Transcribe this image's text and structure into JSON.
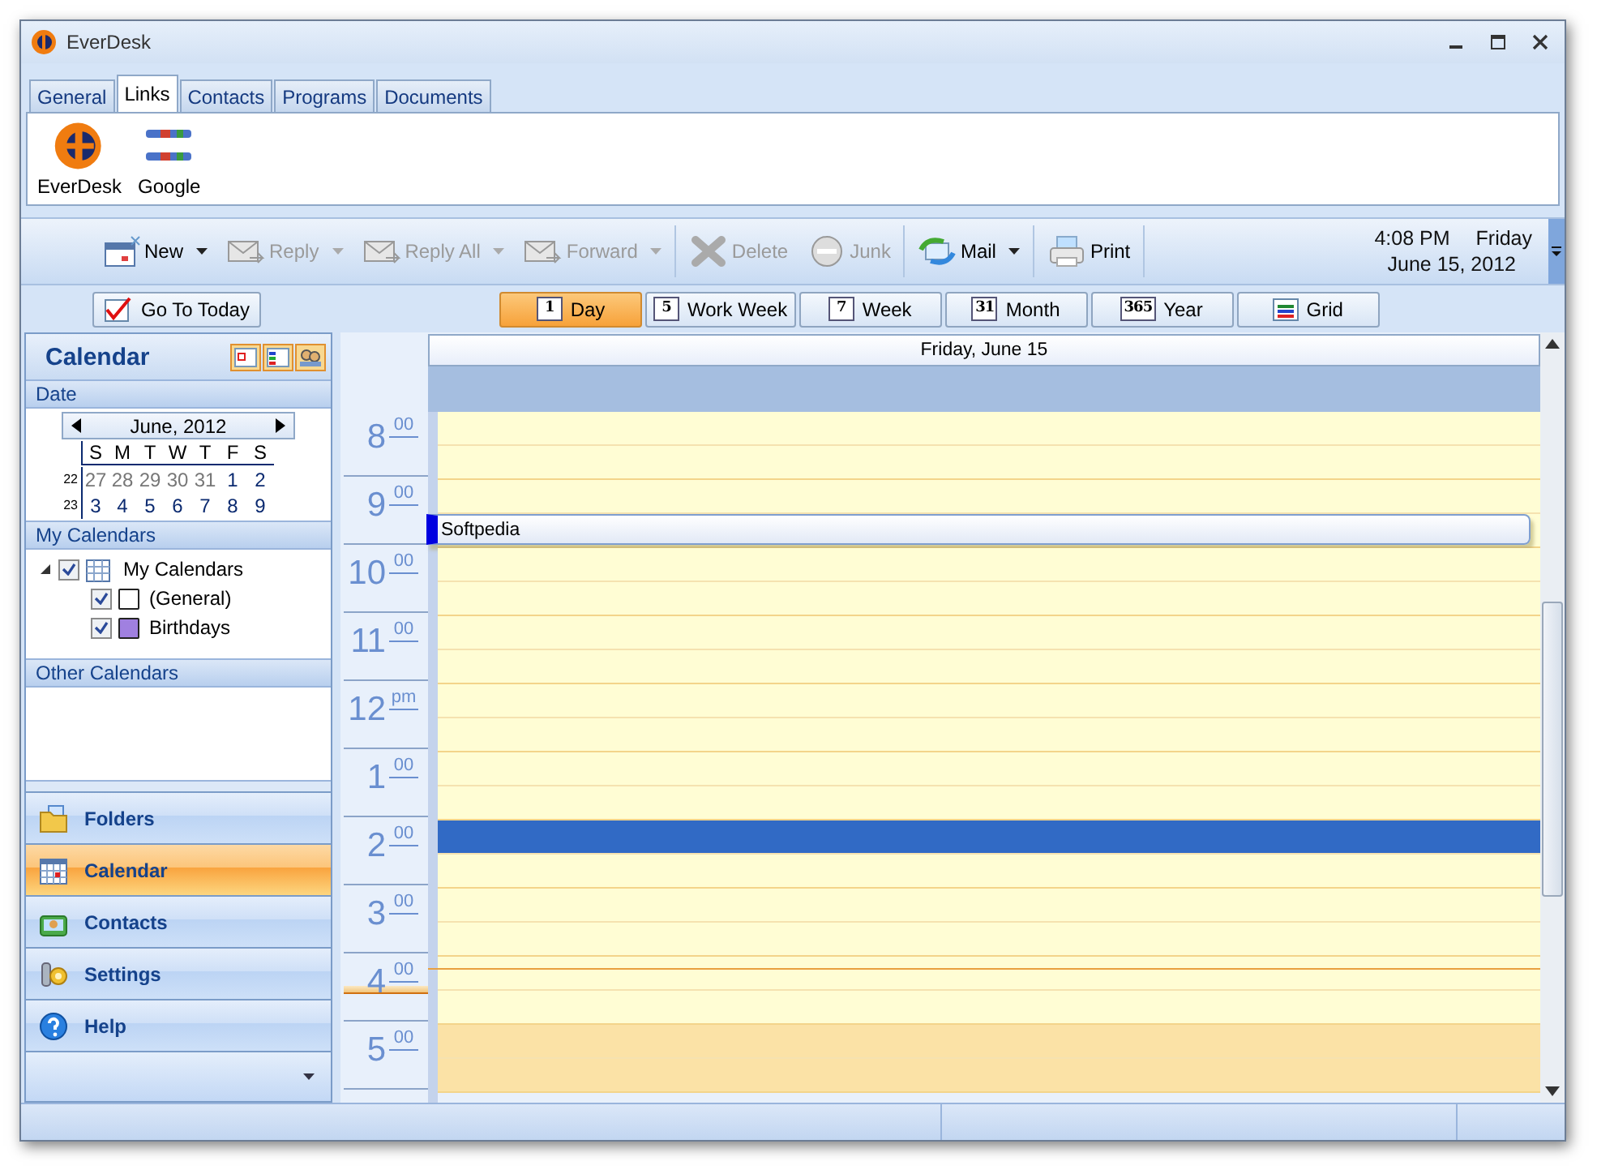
{
  "window": {
    "title": "EverDesk"
  },
  "link_tabs": [
    {
      "label": "General",
      "selected": false
    },
    {
      "label": "Links",
      "selected": true
    },
    {
      "label": "Contacts",
      "selected": false
    },
    {
      "label": "Programs",
      "selected": false
    },
    {
      "label": "Documents",
      "selected": false
    }
  ],
  "links": [
    {
      "label": "EverDesk"
    },
    {
      "label": "Google"
    }
  ],
  "toolbar": [
    {
      "label": "New",
      "disabled": false,
      "dropdown": true,
      "separator_before": false
    },
    {
      "label": "Reply",
      "disabled": true,
      "dropdown": true,
      "separator_before": false
    },
    {
      "label": "Reply All",
      "disabled": true,
      "dropdown": true,
      "separator_before": false
    },
    {
      "label": "Forward",
      "disabled": true,
      "dropdown": true,
      "separator_before": false
    },
    {
      "label": "Delete",
      "disabled": true,
      "dropdown": false,
      "separator_before": true
    },
    {
      "label": "Junk",
      "disabled": true,
      "dropdown": false,
      "separator_before": false
    },
    {
      "label": "Mail",
      "disabled": false,
      "dropdown": true,
      "separator_before": true
    },
    {
      "label": "Print",
      "disabled": false,
      "dropdown": false,
      "separator_before": true
    }
  ],
  "clock": {
    "time": "4:08 PM",
    "day": "Friday",
    "date": "June 15, 2012"
  },
  "go_to_today": "Go To Today",
  "views": [
    {
      "label": "Day",
      "icon_text": "1",
      "selected": true
    },
    {
      "label": "Work Week",
      "icon_text": "5",
      "selected": false
    },
    {
      "label": "Week",
      "icon_text": "7",
      "selected": false
    },
    {
      "label": "Month",
      "icon_text": "31",
      "selected": false
    },
    {
      "label": "Year",
      "icon_text": "365",
      "selected": false
    },
    {
      "label": "Grid",
      "selected": false
    }
  ],
  "sidebar": {
    "title": "Calendar",
    "date_section": "Date",
    "mini_calendar": {
      "month": "June, 2012",
      "weekdays": [
        "S",
        "M",
        "T",
        "W",
        "T",
        "F",
        "S"
      ],
      "weeks": [
        {
          "number": "22",
          "days": [
            {
              "label": "27",
              "other_month": true
            },
            {
              "label": "28",
              "other_month": true
            },
            {
              "label": "29",
              "other_month": true
            },
            {
              "label": "30",
              "other_month": true
            },
            {
              "label": "31",
              "other_month": true
            },
            {
              "label": "1",
              "other_month": false
            },
            {
              "label": "2",
              "other_month": false
            }
          ]
        },
        {
          "number": "23",
          "days": [
            {
              "label": "3",
              "other_month": false
            },
            {
              "label": "4",
              "other_month": false
            },
            {
              "label": "5",
              "other_month": false
            },
            {
              "label": "6",
              "other_month": false
            },
            {
              "label": "7",
              "other_month": false
            },
            {
              "label": "8",
              "other_month": false
            },
            {
              "label": "9",
              "other_month": false
            }
          ]
        }
      ]
    },
    "my_calendars_section": "My Calendars",
    "calendar_tree": {
      "label": "My Calendars",
      "checked": true,
      "expanded": true,
      "children": [
        {
          "label": "(General)",
          "checked": true,
          "color": "#ffffff"
        },
        {
          "label": "Birthdays",
          "checked": true,
          "color": "#a080e0"
        }
      ]
    },
    "other_calendars_section": "Other Calendars",
    "nav": [
      {
        "label": "Folders",
        "selected": false
      },
      {
        "label": "Calendar",
        "selected": true
      },
      {
        "label": "Contacts",
        "selected": false
      },
      {
        "label": "Settings",
        "selected": false
      },
      {
        "label": "Help",
        "selected": false
      }
    ]
  },
  "day_view": {
    "header": "Friday, June 15",
    "hours": [
      {
        "hour": "8",
        "suffix": "00",
        "working": true,
        "slots": [
          {
            "selected": false,
            "now": false
          },
          {
            "selected": false,
            "now": false
          }
        ]
      },
      {
        "hour": "9",
        "suffix": "00",
        "working": true,
        "slots": [
          {
            "selected": false,
            "now": false
          },
          {
            "selected": false,
            "now": false,
            "event": "Softpedia"
          }
        ]
      },
      {
        "hour": "10",
        "suffix": "00",
        "working": true,
        "slots": [
          {
            "selected": false,
            "now": false
          },
          {
            "selected": false,
            "now": false
          }
        ]
      },
      {
        "hour": "11",
        "suffix": "00",
        "working": true,
        "slots": [
          {
            "selected": false,
            "now": false
          },
          {
            "selected": false,
            "now": false
          }
        ]
      },
      {
        "hour": "12",
        "suffix": "pm",
        "working": true,
        "slots": [
          {
            "selected": false,
            "now": false
          },
          {
            "selected": false,
            "now": false
          }
        ]
      },
      {
        "hour": "1",
        "suffix": "00",
        "working": true,
        "slots": [
          {
            "selected": false,
            "now": false
          },
          {
            "selected": false,
            "now": false
          }
        ]
      },
      {
        "hour": "2",
        "suffix": "00",
        "working": true,
        "slots": [
          {
            "selected": true,
            "now": false
          },
          {
            "selected": false,
            "now": false
          }
        ]
      },
      {
        "hour": "3",
        "suffix": "00",
        "working": true,
        "slots": [
          {
            "selected": false,
            "now": false
          },
          {
            "selected": false,
            "now": false
          }
        ]
      },
      {
        "hour": "4",
        "suffix": "00",
        "working": true,
        "slots": [
          {
            "selected": false,
            "now": true
          },
          {
            "selected": false,
            "now": false
          }
        ]
      },
      {
        "hour": "5",
        "suffix": "00",
        "working": false,
        "slots": [
          {
            "selected": false,
            "now": false
          },
          {
            "selected": false,
            "now": false
          }
        ]
      }
    ]
  }
}
